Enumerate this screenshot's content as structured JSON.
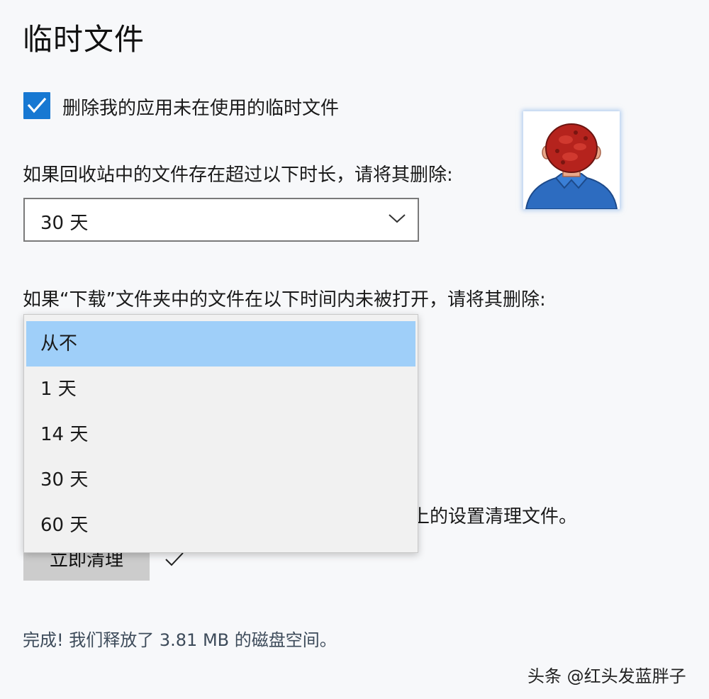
{
  "page": {
    "title": "临时文件"
  },
  "checkbox": {
    "label": "删除我的应用未在使用的临时文件",
    "checked": true,
    "color": "#1778d2"
  },
  "recycle_bin": {
    "question": "如果回收站中的文件存在超过以下时长，请将其删除:",
    "selected": "30 天"
  },
  "downloads": {
    "question": "如果“下载”文件夹中的文件在以下时间内未被打开，请将其删除:",
    "options": [
      "从不",
      "1 天",
      "14 天",
      "30 天",
      "60 天"
    ],
    "highlighted": "从不",
    "highlight_color": "#9fcff9"
  },
  "partial_text": "上的设置清理文件。",
  "clean_button": {
    "label": "立即清理"
  },
  "status": {
    "text": "完成! 我们释放了 3.81 MB 的磁盘空间。"
  },
  "watermark": {
    "text": "头条 @红头发蓝胖子"
  },
  "icons": {
    "checkbox": "checkmark-icon",
    "dropdown": "chevron-down-icon",
    "done": "checkmark-icon",
    "avatar": "red-hair-person-avatar"
  }
}
